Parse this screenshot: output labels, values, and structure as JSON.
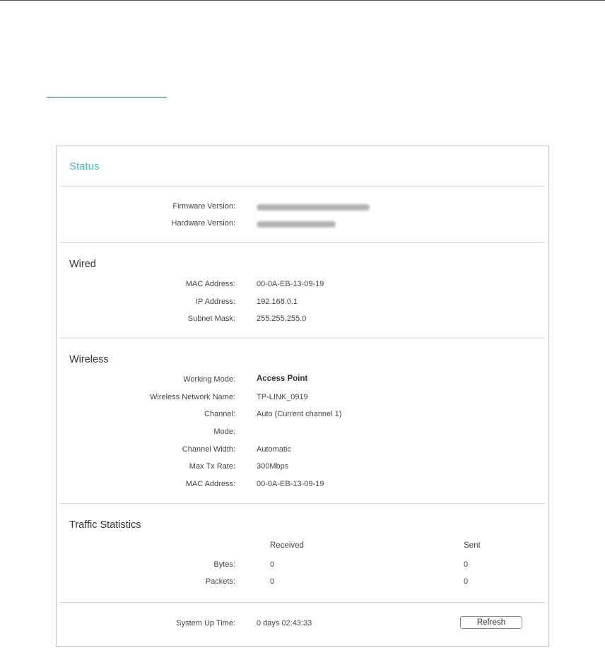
{
  "panel": {
    "title": "Status"
  },
  "device": {
    "firmware_label": "Firmware Version:",
    "hardware_label": "Hardware Version:"
  },
  "wired": {
    "title": "Wired",
    "rows": [
      {
        "label": "MAC Address:",
        "value": "00-0A-EB-13-09-19"
      },
      {
        "label": "IP Address:",
        "value": "192.168.0.1"
      },
      {
        "label": "Subnet Mask:",
        "value": "255.255.255.0"
      }
    ]
  },
  "wireless": {
    "title": "Wireless",
    "rows": [
      {
        "label": "Working Mode:",
        "value": "Access Point"
      },
      {
        "label": "Wireless Network Name:",
        "value": "TP-LINK_0919"
      },
      {
        "label": "Channel:",
        "value": "Auto (Current channel 1)"
      },
      {
        "label": "Mode:",
        "value": ""
      },
      {
        "label": "Channel Width:",
        "value": "Automatic"
      },
      {
        "label": "Max Tx Rate:",
        "value": "300Mbps"
      },
      {
        "label": "MAC Address:",
        "value": "00-0A-EB-13-09-19"
      }
    ]
  },
  "traffic": {
    "title": "Traffic Statistics",
    "col_received": "Received",
    "col_sent": "Sent",
    "rows": [
      {
        "label": "Bytes:",
        "received": "0",
        "sent": "0"
      },
      {
        "label": "Packets:",
        "received": "0",
        "sent": "0"
      }
    ]
  },
  "uptime": {
    "label": "System Up Time:",
    "value": "0 days 02:43:33",
    "refresh_label": "Refresh"
  }
}
